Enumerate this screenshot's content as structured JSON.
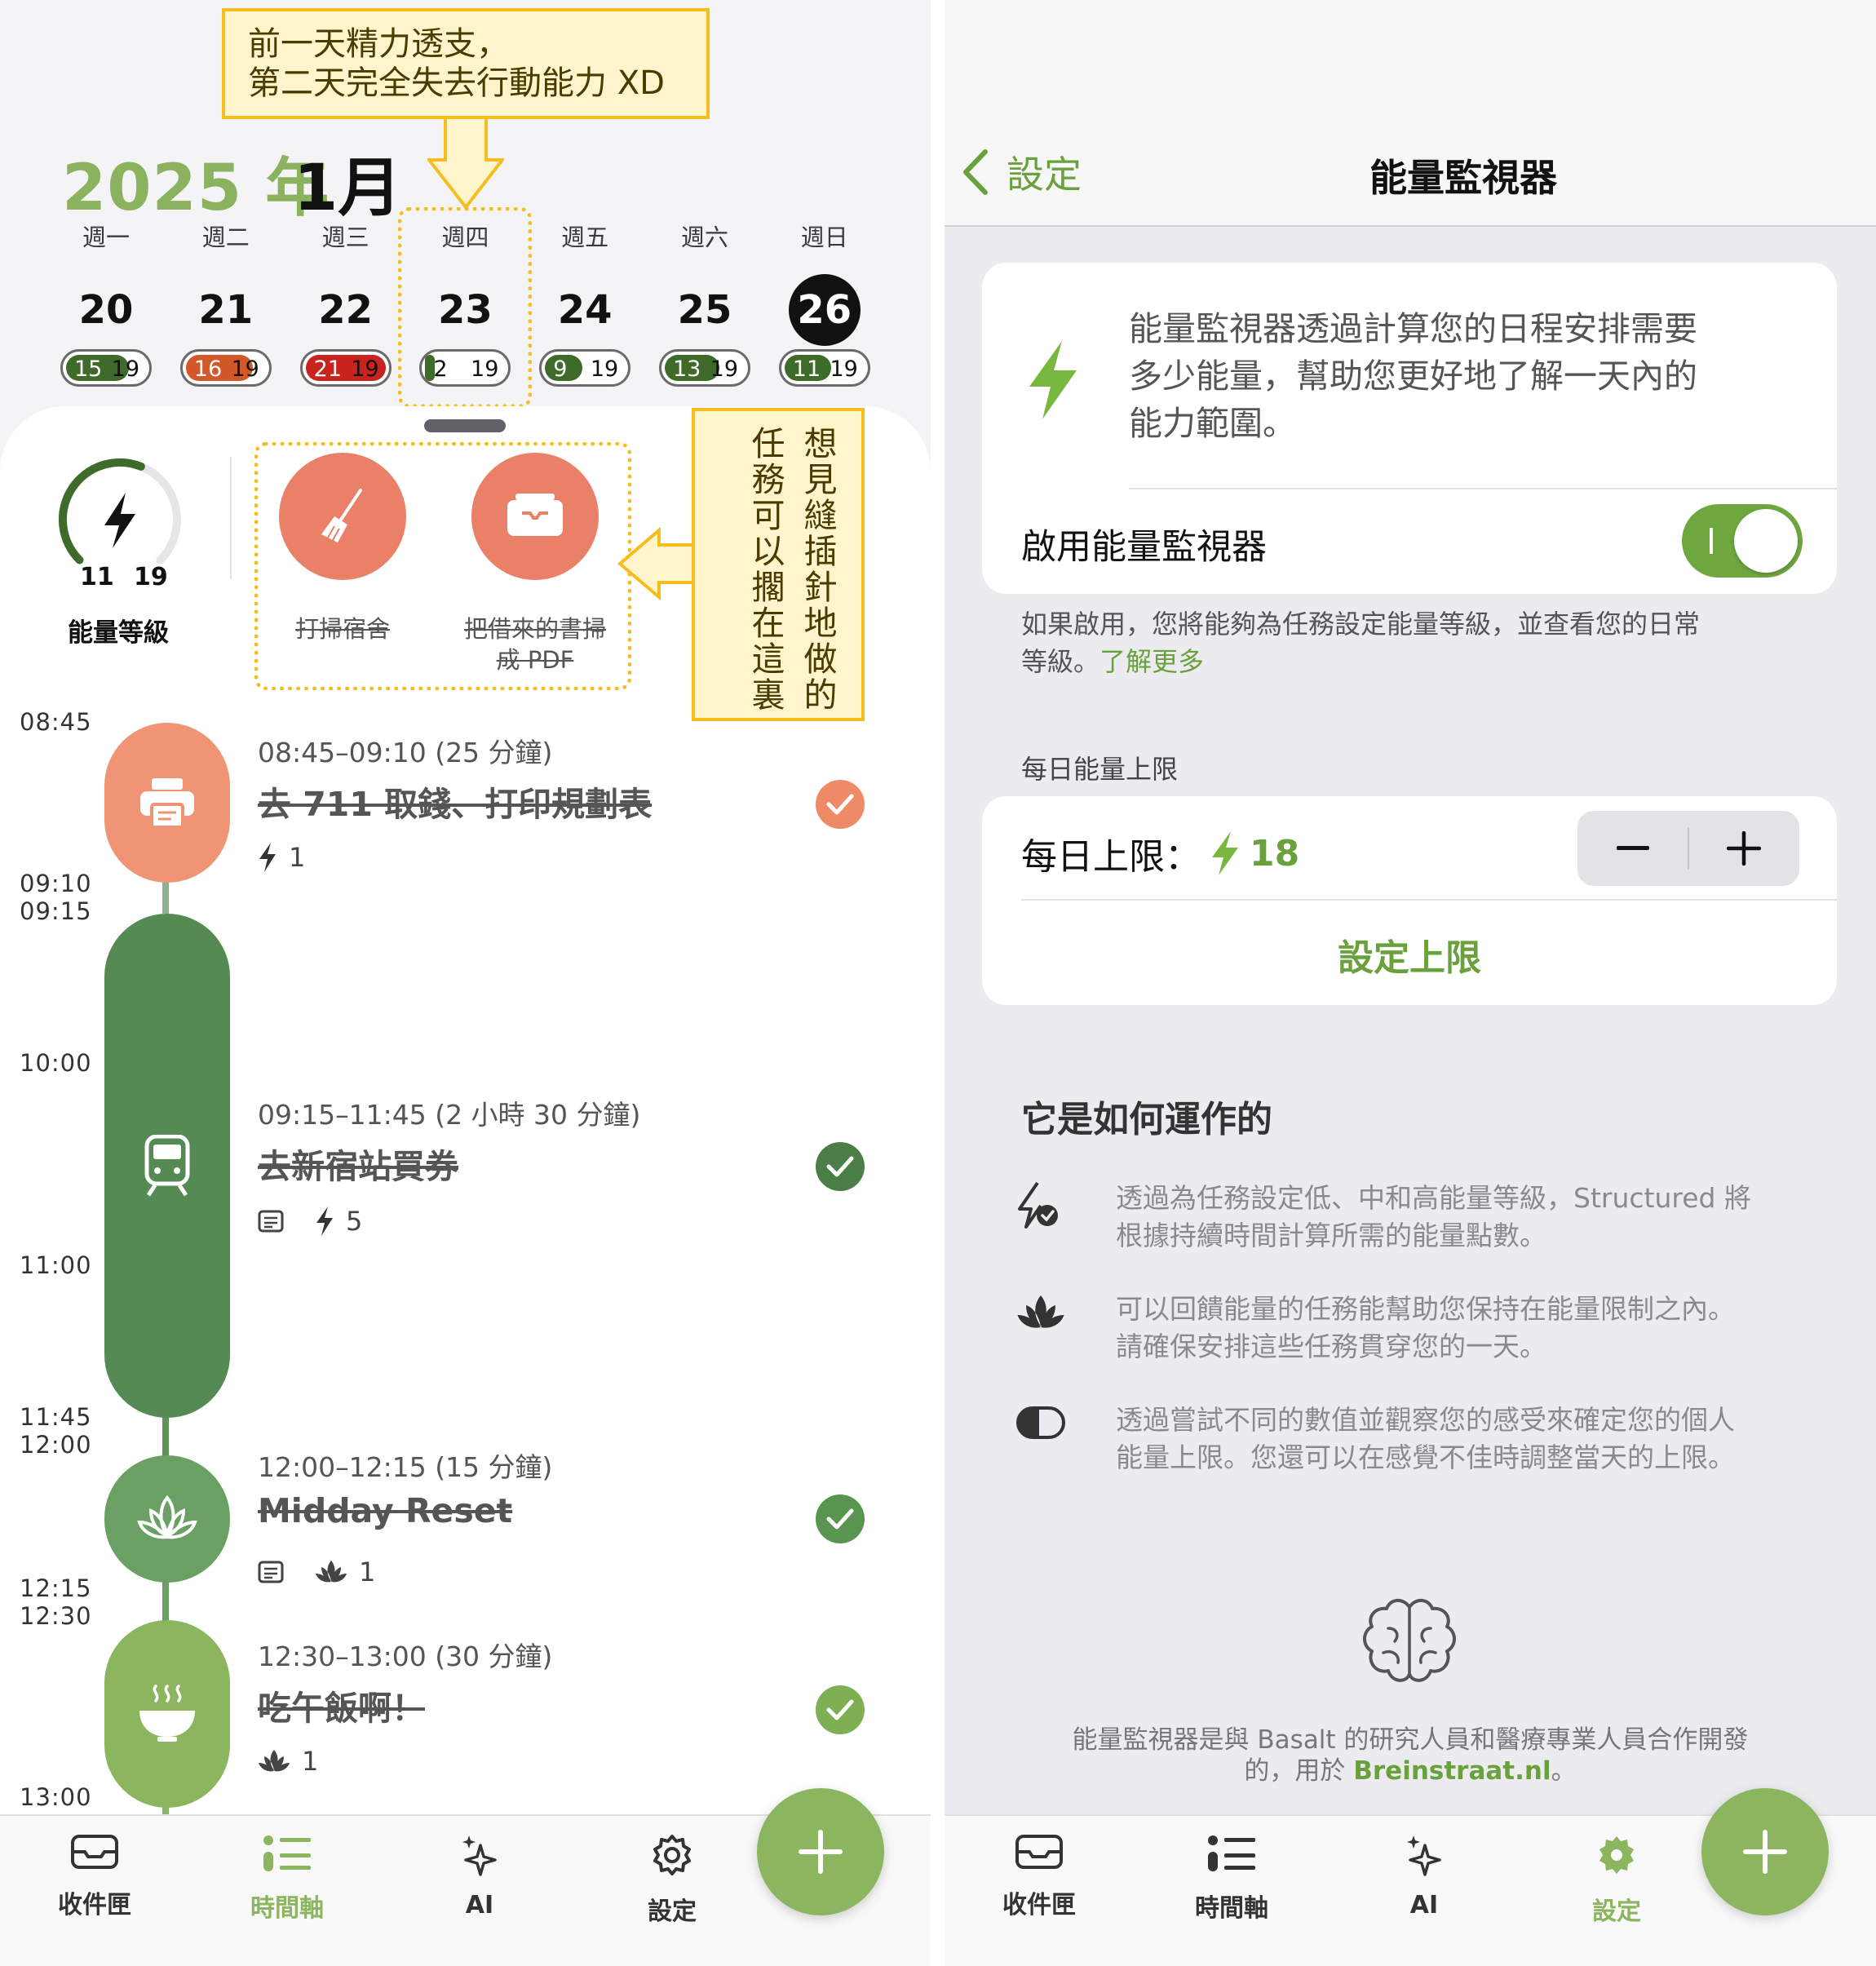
{
  "callout_top": {
    "line1": "前一天精力透支，",
    "line2": "第二天完全失去行動能力 XD"
  },
  "callout_side": {
    "col1": "想見縫插針地做的",
    "col2": "任務可以擱在這裏"
  },
  "calendar": {
    "year": "2025 年",
    "month": "1月",
    "days": [
      {
        "weekday": "週一",
        "date": "20",
        "energy": "15",
        "limit": "19",
        "level": 0.79,
        "color": "#3f6b2a"
      },
      {
        "weekday": "週二",
        "date": "21",
        "energy": "16",
        "limit": "19",
        "level": 0.84,
        "color": "#d2582a"
      },
      {
        "weekday": "週三",
        "date": "22",
        "energy": "21",
        "limit": "19",
        "level": 1.0,
        "color": "#c9231e"
      },
      {
        "weekday": "週四",
        "date": "23",
        "energy": "2",
        "limit": "19",
        "level": 0.1,
        "color": "#3f6b2a"
      },
      {
        "weekday": "週五",
        "date": "24",
        "energy": "9",
        "limit": "19",
        "level": 0.47,
        "color": "#3f6b2a"
      },
      {
        "weekday": "週六",
        "date": "25",
        "energy": "13",
        "limit": "19",
        "level": 0.68,
        "color": "#3f6b2a"
      },
      {
        "weekday": "週日",
        "date": "26",
        "energy": "11",
        "limit": "19",
        "level": 0.58,
        "color": "#3f6b2a"
      }
    ]
  },
  "energy_level": {
    "label": "能量等級",
    "current": "11",
    "limit": "19",
    "level": 0.58
  },
  "inbox": [
    {
      "label": "打掃宿舍",
      "icon": "broom-icon"
    },
    {
      "label_line1": "把借來的書掃",
      "label_line2": "成 PDF",
      "icon": "inbox-tray-icon"
    }
  ],
  "timeline": {
    "times": [
      "08:45",
      "09:10",
      "09:15",
      "10:00",
      "11:00",
      "11:45",
      "12:00",
      "12:15",
      "12:30",
      "13:00"
    ],
    "tasks": [
      {
        "time": "08:45–09:10 (25 分鐘)",
        "title": "去 711 取錢、打印規劃表",
        "energy": "1",
        "icon": "printer-icon",
        "color": "#ef9475",
        "done_color": "#ef8a67"
      },
      {
        "time": "09:15–11:45 (2 小時 30 分鐘)",
        "title": "去新宿站買券",
        "energy": "5",
        "icon": "train-icon",
        "color": "#568a55",
        "done_color": "#4c7f48"
      },
      {
        "time": "12:00–12:15 (15 分鐘)",
        "title": "Midday Reset",
        "energy": "1",
        "icon": "lotus-icon",
        "color": "#6ba064",
        "done_color": "#5a9451"
      },
      {
        "time": "12:30–13:00 (30 分鐘)",
        "title": "吃午飯啊！",
        "energy": "1",
        "icon": "bowl-icon",
        "color": "#8bb55f",
        "done_color": "#7eaf52"
      }
    ]
  },
  "tabbar_left": {
    "inbox": "收件匣",
    "timeline": "時間軸",
    "ai": "AI",
    "settings": "設定",
    "active": "timeline"
  },
  "tabbar_right": {
    "inbox": "收件匣",
    "timeline": "時間軸",
    "ai": "AI",
    "settings": "設定",
    "active": "settings"
  },
  "settings_page": {
    "back_label": "設定",
    "title": "能量監視器",
    "intro_line1": "能量監視器透過計算您的日程安排需要",
    "intro_line2": "多少能量，幫助您更好地了解一天內的",
    "intro_line3": "能力範圍。",
    "enable_label": "啟用能量監視器",
    "enable_on": true,
    "footnote_line1": "如果啟用，您將能夠為任務設定能量等級，並查看您的日常",
    "footnote_line2": "等級。",
    "learn_more": "了解更多",
    "daily_section": "每日能量上限",
    "daily_label": "每日上限：",
    "daily_value": "18",
    "set_limit": "設定上限",
    "how_title": "它是如何運作的",
    "how": [
      {
        "line1": "透過為任務設定低、中和高能量等級，Structured 將",
        "line2": "根據持續時間計算所需的能量點數。",
        "icon": "energy-check-icon"
      },
      {
        "line1": "可以回饋能量的任務能幫助您保持在能量限制之內。",
        "line2": "請確保安排這些任務貫穿您的一天。",
        "icon": "lotus-icon"
      },
      {
        "line1": "透過嘗試不同的數值並觀察您的感受來確定您的個人",
        "line2": "能量上限。您還可以在感覺不佳時調整當天的上限。",
        "icon": "toggle-half-icon"
      }
    ],
    "credit_line1": "能量監視器是與 Basalt 的研究人員和醫療專業人員合作開發",
    "credit_prefix": "的，用於",
    "credit_link": "Breinstraat.nl",
    "credit_suffix": "。"
  }
}
